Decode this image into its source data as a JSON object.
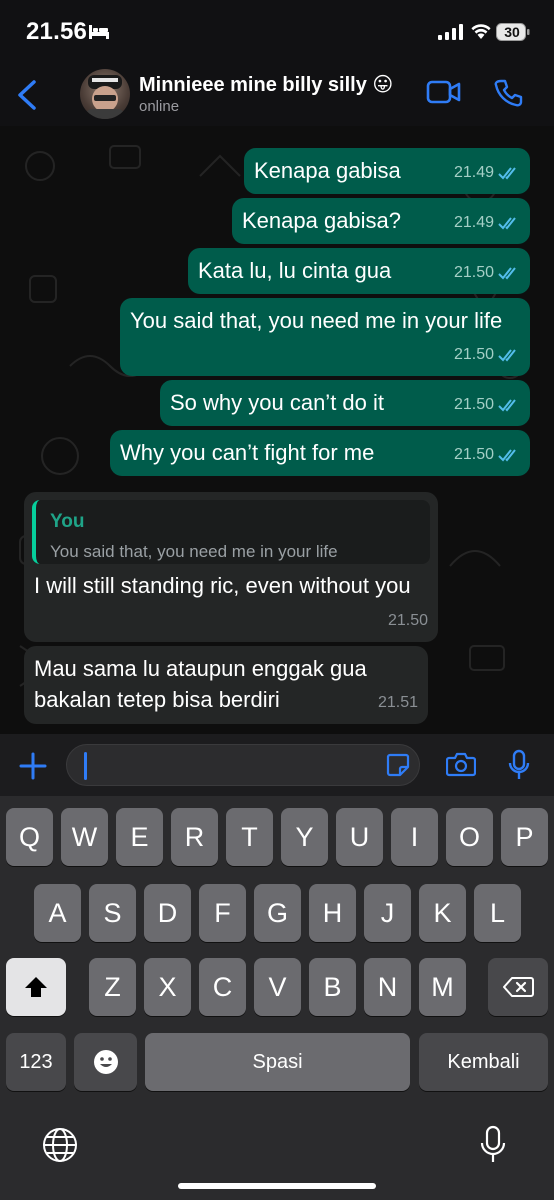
{
  "status_bar": {
    "time": "21.56",
    "battery": "30"
  },
  "header": {
    "contact_name": "Minnieee mine billy silly 😛",
    "status": "online"
  },
  "messages": [
    {
      "direction": "out",
      "text": "Kenapa gabisa",
      "time": "21.49"
    },
    {
      "direction": "out",
      "text": "Kenapa gabisa?",
      "time": "21.49"
    },
    {
      "direction": "out",
      "text": "Kata lu, lu cinta gua",
      "time": "21.50"
    },
    {
      "direction": "out",
      "text": "You said that, you need me in your life",
      "time": "21.50"
    },
    {
      "direction": "out",
      "text": "So why you can’t do it",
      "time": "21.50"
    },
    {
      "direction": "out",
      "text": "Why you can’t fight for me",
      "time": "21.50"
    },
    {
      "direction": "in",
      "reply_author": "You",
      "reply_text": "You said that, you need me in your life",
      "text": "I will still standing ric, even without you",
      "time": "21.50"
    },
    {
      "direction": "in",
      "text": "Mau sama lu ataupun enggak gua bakalan tetep bisa berdiri",
      "time": "21.51"
    }
  ],
  "composer": {
    "value": ""
  },
  "keyboard": {
    "row1": [
      "Q",
      "W",
      "E",
      "R",
      "T",
      "Y",
      "U",
      "I",
      "O",
      "P"
    ],
    "row2": [
      "A",
      "S",
      "D",
      "F",
      "G",
      "H",
      "J",
      "K",
      "L"
    ],
    "row3": [
      "Z",
      "X",
      "C",
      "V",
      "B",
      "N",
      "M"
    ],
    "numbers_label": "123",
    "space_label": "Spasi",
    "return_label": "Kembali"
  },
  "colors": {
    "outgoing_bubble": "#005c4b",
    "incoming_bubble": "#242626",
    "accent": "#2f7cf6"
  },
  "icons": [
    "bed-icon",
    "signal-icon",
    "wifi-icon",
    "battery-icon",
    "back-arrow-icon",
    "video-call-icon",
    "phone-icon",
    "plus-icon",
    "sticker-icon",
    "camera-icon",
    "microphone-icon",
    "shift-icon",
    "backspace-icon",
    "emoji-icon",
    "globe-icon",
    "dictation-icon",
    "double-check-icon"
  ]
}
